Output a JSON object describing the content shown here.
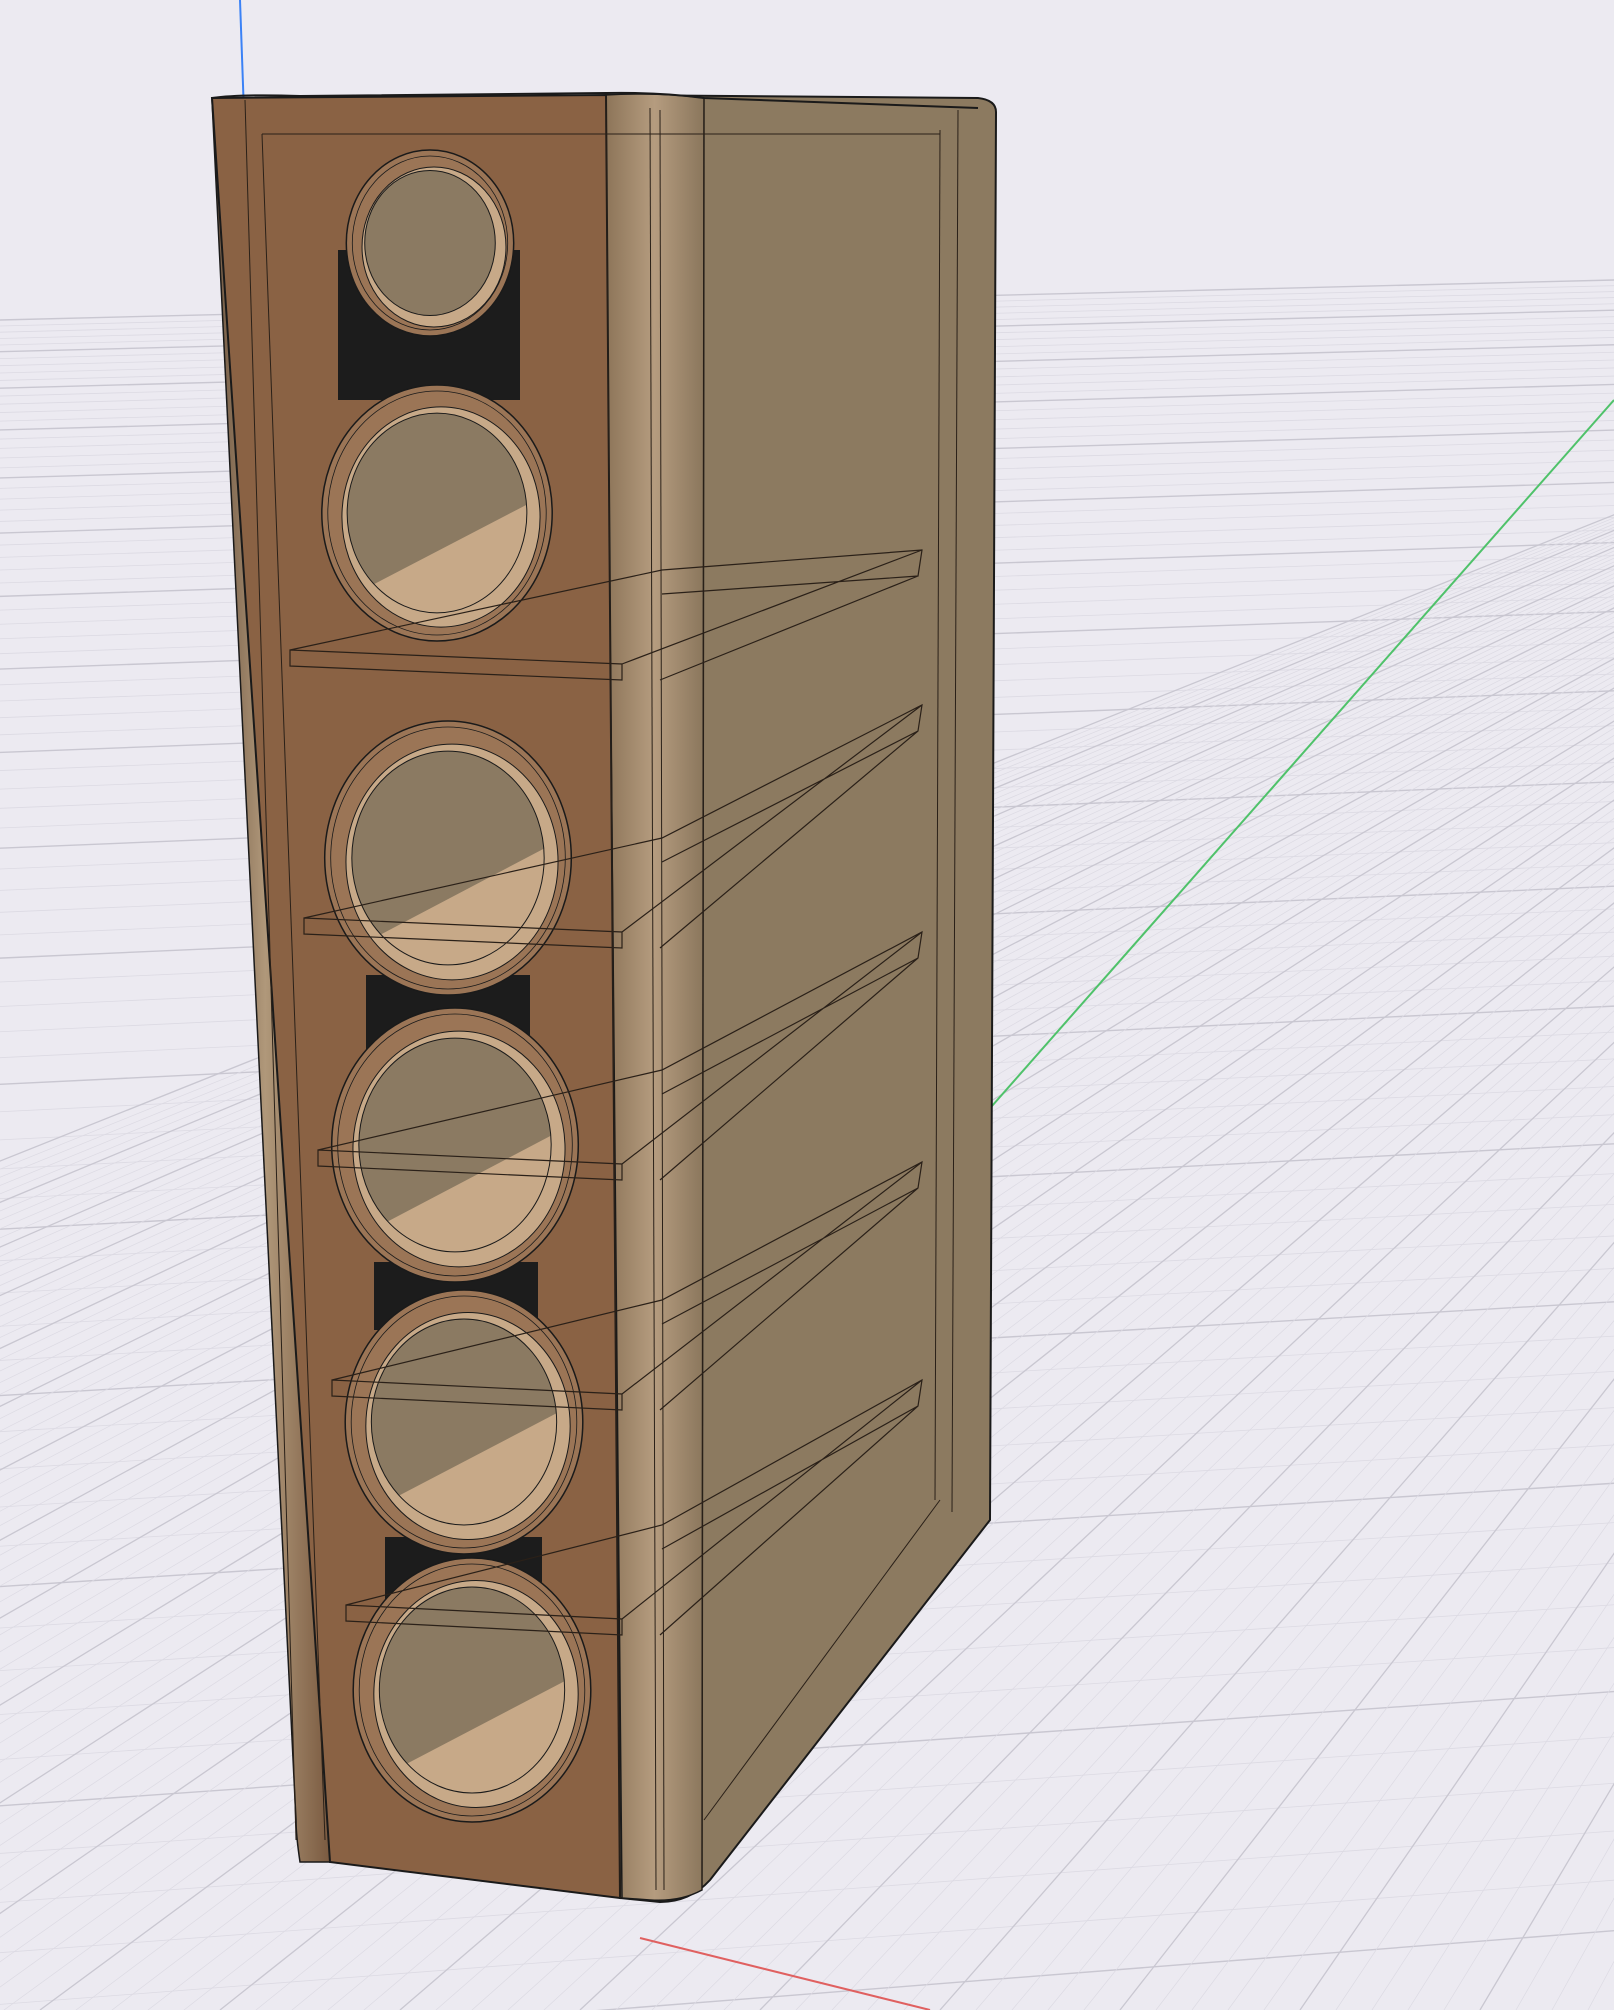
{
  "viewport": {
    "background_color": "#eceaf1",
    "grid_minor_color": "#dcdae3",
    "grid_major_color": "#c9c7d1",
    "axes": {
      "x_color": "#e06060",
      "y_color": "#4fc26a",
      "z_color": "#3b82f6"
    }
  },
  "model": {
    "kind": "floor-standing loudspeaker enclosure",
    "driver_count": 6,
    "tweeter_count": 1,
    "woofer_count": 5,
    "internal_shelves": 5,
    "colors": {
      "front_panel": "#8a6244",
      "side_panel": "#8c7a60",
      "rounded_edge": "#a68d70",
      "driver_cavity": "#8b7a62",
      "cone_lit": "#c7a988",
      "ring": "#9b7556",
      "slot": "#1c1c1c",
      "edge": "#1a1a1a"
    }
  }
}
